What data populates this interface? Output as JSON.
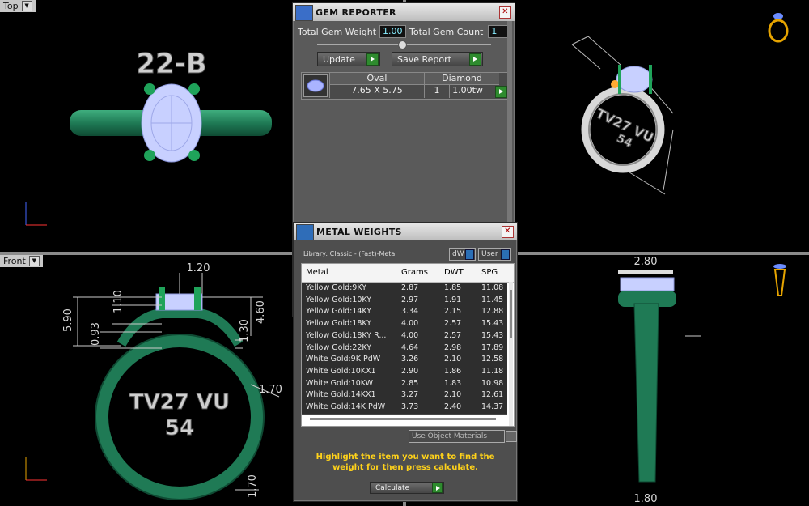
{
  "viewports": {
    "top": {
      "label": "Top"
    },
    "front": {
      "label": "Front"
    }
  },
  "top_view": {
    "tag": "22-B"
  },
  "front_view": {
    "engraving_line1": "TV27 VU",
    "engraving_line2": "54",
    "dims": {
      "d1": "1.20",
      "d2": "5.90",
      "d3": "1.10",
      "d4": "4.60",
      "d5": "0.93",
      "d6": "1.30",
      "d7": "1.70",
      "d8": "1.70"
    }
  },
  "right_view": {
    "dims": {
      "top": "2.80",
      "bottom": "1.80"
    }
  },
  "persp_view": {
    "engraving_line1": "TV27 VU",
    "engraving_line2": "54"
  },
  "gem_reporter": {
    "title": "GEM REPORTER",
    "total_weight_label": "Total Gem Weight",
    "total_weight_value": "1.00",
    "total_count_label": "Total Gem Count",
    "total_count_value": "1",
    "update_label": "Update",
    "save_report_label": "Save Report",
    "table": {
      "shape": "Oval",
      "size": "7.65 X 5.75",
      "stone": "Diamond",
      "qty": "1",
      "weight": "1.00tw"
    }
  },
  "metal_weights": {
    "title": "METAL WEIGHTS",
    "library": "Library: Classic - (Fast)-Metal",
    "dw_label": "dW",
    "user_label": "User",
    "columns": [
      "Metal",
      "Grams",
      "DWT",
      "SPG"
    ],
    "rows": [
      [
        "Yellow Gold:9KY",
        "2.87",
        "1.85",
        "11.08"
      ],
      [
        "Yellow Gold:10KY",
        "2.97",
        "1.91",
        "11.45"
      ],
      [
        "Yellow Gold:14KY",
        "3.34",
        "2.15",
        "12.88"
      ],
      [
        "Yellow Gold:18KY",
        "4.00",
        "2.57",
        "15.43"
      ],
      [
        "Yellow Gold:18KY R...",
        "4.00",
        "2.57",
        "15.43"
      ],
      [
        "Yellow Gold:22KY",
        "4.64",
        "2.98",
        "17.89"
      ],
      [
        "White Gold:9K PdW",
        "3.26",
        "2.10",
        "12.58"
      ],
      [
        "White Gold:10KX1",
        "2.90",
        "1.86",
        "11.18"
      ],
      [
        "White Gold:10KW",
        "2.85",
        "1.83",
        "10.98"
      ],
      [
        "White Gold:14KX1",
        "3.27",
        "2.10",
        "12.61"
      ],
      [
        "White Gold:14K PdW",
        "3.73",
        "2.40",
        "14.37"
      ]
    ],
    "use_object_materials": "Use Object Materials",
    "hint": "Highlight the item you want to find the weight for then press calculate.",
    "calculate_label": "Calculate"
  },
  "colors": {
    "ring": "#1f7a55",
    "gem": "#c8d0ff",
    "prong": "#1fa35a",
    "highlight": "#ffd21a"
  }
}
